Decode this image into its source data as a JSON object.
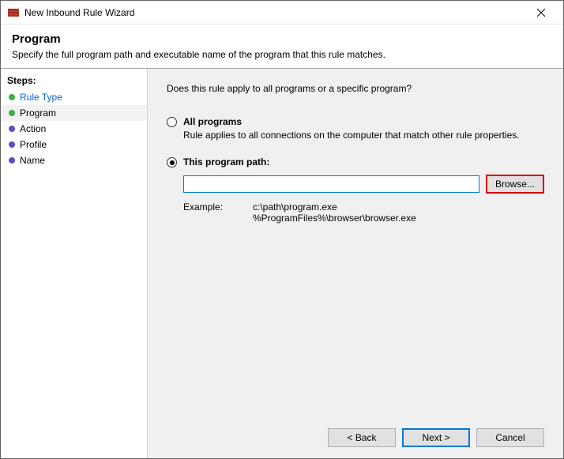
{
  "window": {
    "title": "New Inbound Rule Wizard"
  },
  "header": {
    "title": "Program",
    "subtitle": "Specify the full program path and executable name of the program that this rule matches."
  },
  "sidebar": {
    "heading": "Steps:",
    "items": [
      {
        "label": "Rule Type",
        "state": "done"
      },
      {
        "label": "Program",
        "state": "current"
      },
      {
        "label": "Action",
        "state": "future"
      },
      {
        "label": "Profile",
        "state": "future"
      },
      {
        "label": "Name",
        "state": "future"
      }
    ]
  },
  "content": {
    "question": "Does this rule apply to all programs or a specific program?",
    "options": {
      "all": {
        "label": "All programs",
        "desc": "Rule applies to all connections on the computer that match other rule properties.",
        "selected": false
      },
      "path": {
        "label": "This program path:",
        "selected": true,
        "value": "",
        "browse": "Browse...",
        "example_label": "Example:",
        "example_paths": "c:\\path\\program.exe\n%ProgramFiles%\\browser\\browser.exe"
      }
    }
  },
  "footer": {
    "back": "< Back",
    "next": "Next >",
    "cancel": "Cancel"
  }
}
